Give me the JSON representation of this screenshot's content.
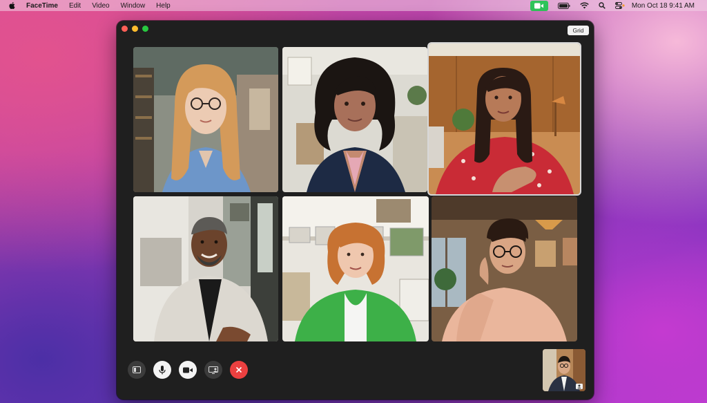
{
  "menubar": {
    "app_name": "FaceTime",
    "items": [
      "Edit",
      "Video",
      "Window",
      "Help"
    ],
    "clock": "Mon Oct 18  9:41 AM",
    "icons": [
      "apple-logo-icon",
      "facetime-camera-icon",
      "battery-icon",
      "wifi-icon",
      "search-icon",
      "control-center-icon"
    ]
  },
  "window": {
    "grid_label": "Grid",
    "participants": [
      {
        "name": "participant-1"
      },
      {
        "name": "participant-2"
      },
      {
        "name": "participant-3"
      },
      {
        "name": "participant-4"
      },
      {
        "name": "participant-5"
      },
      {
        "name": "participant-6"
      }
    ],
    "controls": [
      "sidebar-icon",
      "microphone-icon",
      "camera-icon",
      "share-screen-icon",
      "end-call-icon"
    ]
  },
  "colors": {
    "accent_green": "#2fc45a",
    "end_call_red": "#ec4040",
    "window_bg": "#1f1f1f"
  }
}
